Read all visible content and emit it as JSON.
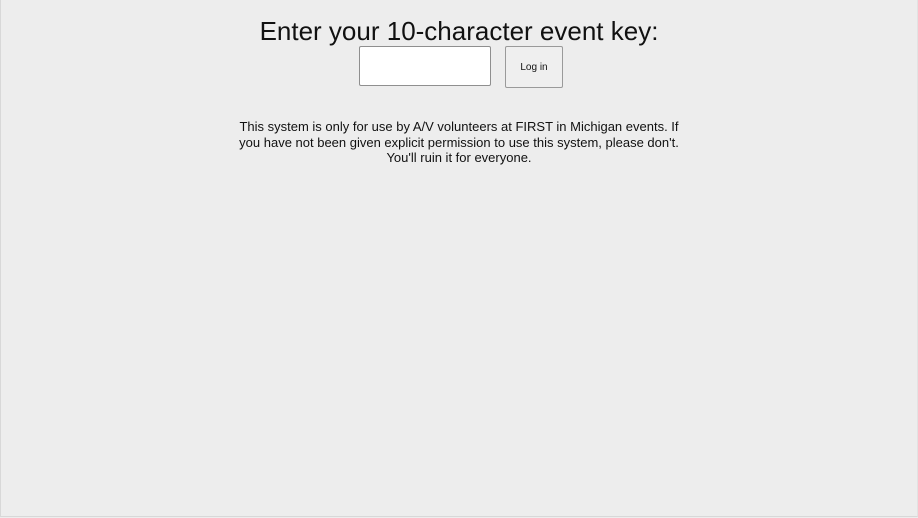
{
  "login": {
    "title": "Enter your 10-character event key:",
    "input_value": "",
    "input_placeholder": "",
    "button_label": "Log in"
  },
  "notice": {
    "text": "This system is only for use by A/V volunteers at FIRST in Michigan events. If you have not been given explicit permission to use this system, please don't. You'll ruin it for everyone."
  },
  "colors": {
    "background": "#ededed",
    "text": "#111111",
    "input_background": "#ffffff",
    "button_background": "#efefef"
  }
}
